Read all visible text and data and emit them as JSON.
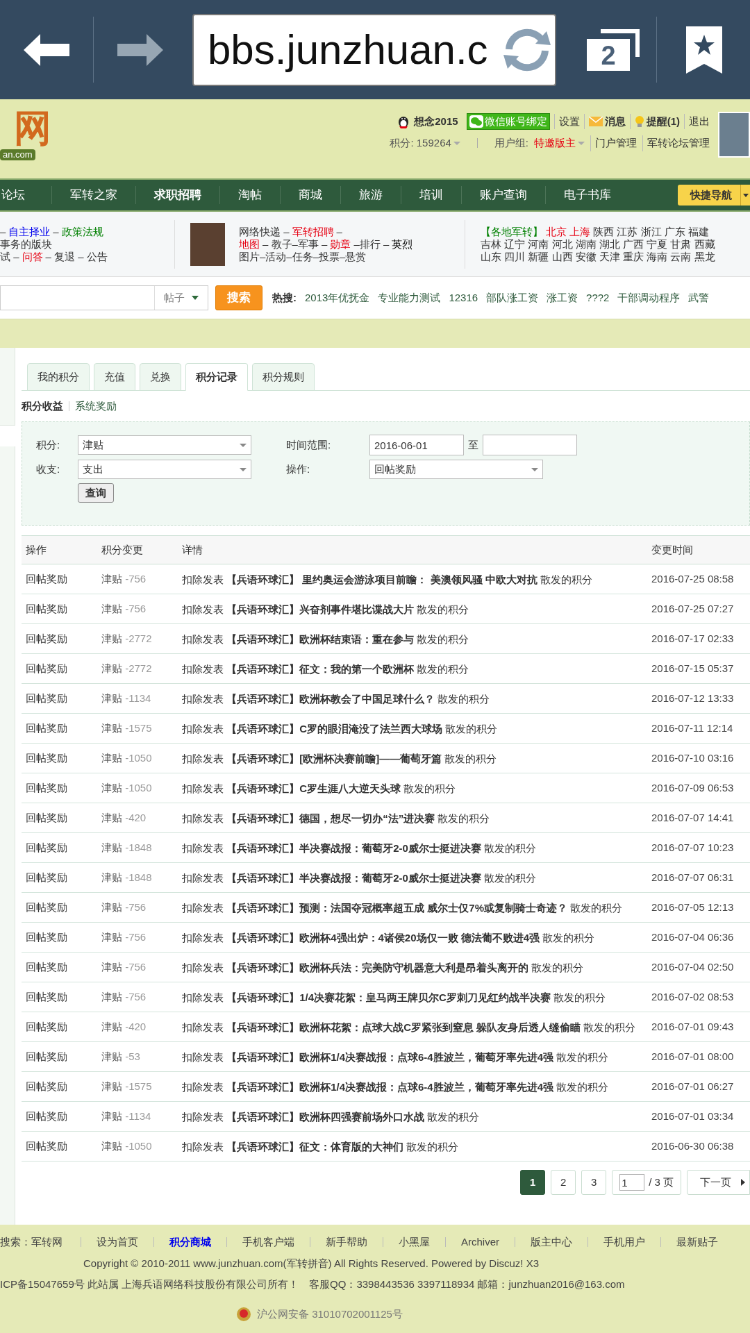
{
  "browser": {
    "url": "bbs.junzhuan.c",
    "tab_count": "2"
  },
  "header": {
    "logo_text": "网",
    "logo_sub": "an.com",
    "user": "想念2015",
    "wechat": "微信账号绑定",
    "settings": "设置",
    "messages": "消息",
    "reminders": "提醒(1)",
    "logout": "退出",
    "points": "积分: 159264",
    "group_label": "用户组:",
    "group": "特邀版主",
    "admin_links": [
      "门户管理",
      "军转论坛管理"
    ]
  },
  "nav": {
    "items": [
      {
        "label": "论坛",
        "bold": false
      },
      {
        "label": "军转之家",
        "bold": false
      },
      {
        "label": "求职招聘",
        "bold": true
      },
      {
        "label": "淘帖",
        "bold": false
      },
      {
        "label": "商城",
        "bold": false
      },
      {
        "label": "旅游",
        "bold": false
      },
      {
        "label": "培训",
        "bold": false
      },
      {
        "label": "账户查询",
        "bold": false
      },
      {
        "label": "电子书库",
        "bold": false
      }
    ],
    "quick_nav": "快捷导航"
  },
  "info": {
    "columns": [
      {
        "lines": [
          [
            {
              "text": "–",
              "color": "#333333"
            },
            {
              "text": "自主择业",
              "color": "#0000ee"
            },
            {
              "text": "–",
              "color": "#333333"
            },
            {
              "text": "政策法规",
              "color": "#008000"
            }
          ],
          [
            {
              "text": "事务的版块",
              "color": "#333333"
            }
          ],
          [
            {
              "text": "试 –",
              "color": "#333333"
            },
            {
              "text": "问答",
              "color": "#e60012"
            },
            {
              "text": "– 复退 – 公告",
              "color": "#333333"
            }
          ]
        ]
      },
      {
        "lines": [
          [
            {
              "text": "网络快递 –",
              "color": "#333333"
            },
            {
              "text": "军转招聘",
              "color": "#e60012"
            },
            {
              "text": "–",
              "color": "#333333"
            }
          ],
          [
            {
              "text": "地图",
              "color": "#e60012"
            },
            {
              "text": "– 教子–军事 –",
              "color": "#333333"
            },
            {
              "text": "勋章",
              "color": "#e60012"
            },
            {
              "text": "–排行 –",
              "color": "#333333"
            },
            {
              "text": "英烈",
              "color": "#000000"
            }
          ],
          [
            {
              "text": "图片–活动–任务–投票–悬赏",
              "color": "#333333"
            }
          ]
        ]
      },
      {
        "lines": [
          [
            {
              "text": "【各地军转】",
              "color": "#008000"
            },
            {
              "text": "北京 上海",
              "color": "#e60012"
            },
            {
              "text": "陕西 江苏 浙江 广东 福建",
              "color": "#333333"
            }
          ],
          [
            {
              "text": "吉林 辽宁 河南 河北 湖南 湖北 广西 宁夏 甘肃 西藏",
              "color": "#333333"
            }
          ],
          [
            {
              "text": "山东 四川 新疆 山西 安徽 天津 重庆 海南 云南 黑龙",
              "color": "#333333"
            }
          ]
        ]
      }
    ]
  },
  "search": {
    "scope": "帖子",
    "button": "搜索",
    "hot_label": "热搜:",
    "hot_terms": [
      "2013年优抚金",
      "专业能力测试",
      "12316",
      "部队涨工资",
      "涨工资",
      "???2",
      "干部调动程序",
      "武警"
    ]
  },
  "tabs": [
    {
      "label": "我的积分",
      "selected": false
    },
    {
      "label": "充值",
      "selected": false
    },
    {
      "label": "兑换",
      "selected": false
    },
    {
      "label": "积分记录",
      "selected": true
    },
    {
      "label": "积分规则",
      "selected": false
    }
  ],
  "subtabs": [
    {
      "label": "积分收益",
      "selected": true
    },
    {
      "label": "系统奖励",
      "selected": false
    }
  ],
  "filter": {
    "points_label": "积分:",
    "points_value": "津贴",
    "flow_label": "收支:",
    "flow_value": "支出",
    "range_label": "时间范围:",
    "range_from": "2016-06-01",
    "range_to_label": "至",
    "action_label": "操作:",
    "action_value": "回帖奖励",
    "query_button": "查询"
  },
  "table": {
    "columns": [
      "操作",
      "积分变更",
      "详情",
      "变更时间"
    ],
    "rows": [
      {
        "action": "回帖奖励",
        "type": "津贴",
        "amount": "-756",
        "prefix": "扣除发表",
        "title": "【兵语环球汇】 里约奥运会游泳项目前瞻： 美澳领风骚 中欧大对抗",
        "suffix": "散发的积分",
        "time": "2016-07-25 08:58"
      },
      {
        "action": "回帖奖励",
        "type": "津贴",
        "amount": "-756",
        "prefix": "扣除发表",
        "title": "【兵语环球汇】兴奋剂事件堪比谍战大片",
        "suffix": "散发的积分",
        "time": "2016-07-25 07:27"
      },
      {
        "action": "回帖奖励",
        "type": "津贴",
        "amount": "-2772",
        "prefix": "扣除发表",
        "title": "【兵语环球汇】欧洲杯结束语：重在参与",
        "suffix": "散发的积分",
        "time": "2016-07-17 02:33"
      },
      {
        "action": "回帖奖励",
        "type": "津贴",
        "amount": "-2772",
        "prefix": "扣除发表",
        "title": "【兵语环球汇】征文：我的第一个欧洲杯",
        "suffix": "散发的积分",
        "time": "2016-07-15 05:37"
      },
      {
        "action": "回帖奖励",
        "type": "津贴",
        "amount": "-1134",
        "prefix": "扣除发表",
        "title": "【兵语环球汇】欧洲杯教会了中国足球什么？",
        "suffix": "散发的积分",
        "time": "2016-07-12 13:33"
      },
      {
        "action": "回帖奖励",
        "type": "津贴",
        "amount": "-1575",
        "prefix": "扣除发表",
        "title": "【兵语环球汇】C罗的眼泪淹没了法兰西大球场",
        "suffix": "散发的积分",
        "time": "2016-07-11 12:14"
      },
      {
        "action": "回帖奖励",
        "type": "津贴",
        "amount": "-1050",
        "prefix": "扣除发表",
        "title": "【兵语环球汇】[欧洲杯决赛前瞻]——葡萄牙篇",
        "suffix": "散发的积分",
        "time": "2016-07-10 03:16"
      },
      {
        "action": "回帖奖励",
        "type": "津贴",
        "amount": "-1050",
        "prefix": "扣除发表",
        "title": "【兵语环球汇】C罗生涯八大逆天头球",
        "suffix": "散发的积分",
        "time": "2016-07-09 06:53"
      },
      {
        "action": "回帖奖励",
        "type": "津贴",
        "amount": "-420",
        "prefix": "扣除发表",
        "title": "【兵语环球汇】德国，想尽一切办“法”进决赛",
        "suffix": "散发的积分",
        "time": "2016-07-07 14:41"
      },
      {
        "action": "回帖奖励",
        "type": "津贴",
        "amount": "-1848",
        "prefix": "扣除发表",
        "title": "【兵语环球汇】半决赛战报：葡萄牙2-0威尔士挺进决赛",
        "suffix": "散发的积分",
        "time": "2016-07-07 10:23"
      },
      {
        "action": "回帖奖励",
        "type": "津贴",
        "amount": "-1848",
        "prefix": "扣除发表",
        "title": "【兵语环球汇】半决赛战报：葡萄牙2-0威尔士挺进决赛",
        "suffix": "散发的积分",
        "time": "2016-07-07 06:31"
      },
      {
        "action": "回帖奖励",
        "type": "津贴",
        "amount": "-756",
        "prefix": "扣除发表",
        "title": "【兵语环球汇】预测：法国夺冠概率超五成 威尔士仅7%或复制骑士奇迹？",
        "suffix": "散发的积分",
        "time": "2016-07-05 12:13"
      },
      {
        "action": "回帖奖励",
        "type": "津贴",
        "amount": "-756",
        "prefix": "扣除发表",
        "title": "【兵语环球汇】欧洲杯4强出炉：4诸侯20场仅一败 德法葡不败进4强",
        "suffix": "散发的积分",
        "time": "2016-07-04 06:36"
      },
      {
        "action": "回帖奖励",
        "type": "津贴",
        "amount": "-756",
        "prefix": "扣除发表",
        "title": "【兵语环球汇】欧洲杯兵法：完美防守机器意大利是昂着头离开的",
        "suffix": "散发的积分",
        "time": "2016-07-04 02:50"
      },
      {
        "action": "回帖奖励",
        "type": "津贴",
        "amount": "-756",
        "prefix": "扣除发表",
        "title": "【兵语环球汇】1/4决赛花絮：皇马两王牌贝尔C罗刺刀见红约战半决赛",
        "suffix": "散发的积分",
        "time": "2016-07-02 08:53"
      },
      {
        "action": "回帖奖励",
        "type": "津贴",
        "amount": "-420",
        "prefix": "扣除发表",
        "title": "【兵语环球汇】欧洲杯花絮：点球大战C罗紧张到窒息 躲队友身后透人缝偷瞄",
        "suffix": "散发的积分",
        "time": "2016-07-01 09:43"
      },
      {
        "action": "回帖奖励",
        "type": "津贴",
        "amount": "-53",
        "prefix": "扣除发表",
        "title": "【兵语环球汇】欧洲杯1/4决赛战报：点球6-4胜波兰，葡萄牙率先进4强",
        "suffix": "散发的积分",
        "time": "2016-07-01 08:00"
      },
      {
        "action": "回帖奖励",
        "type": "津贴",
        "amount": "-1575",
        "prefix": "扣除发表",
        "title": "【兵语环球汇】欧洲杯1/4决赛战报：点球6-4胜波兰，葡萄牙率先进4强",
        "suffix": "散发的积分",
        "time": "2016-07-01 06:27"
      },
      {
        "action": "回帖奖励",
        "type": "津贴",
        "amount": "-1134",
        "prefix": "扣除发表",
        "title": "【兵语环球汇】欧洲杯四强赛前场外口水战",
        "suffix": "散发的积分",
        "time": "2016-07-01 03:34"
      },
      {
        "action": "回帖奖励",
        "type": "津贴",
        "amount": "-1050",
        "prefix": "扣除发表",
        "title": "【兵语环球汇】征文：体育版的大神们",
        "suffix": "散发的积分",
        "time": "2016-06-30 06:38"
      }
    ]
  },
  "pagination": {
    "pages": [
      {
        "label": "1",
        "selected": true
      },
      {
        "label": "2",
        "selected": false
      },
      {
        "label": "3",
        "selected": false
      }
    ],
    "page_input": "1",
    "total": "/ 3 页",
    "next": "下一页"
  },
  "footer": {
    "links": [
      {
        "label": "搜索：军转网",
        "bold": false
      },
      {
        "label": "设为首页",
        "bold": false
      },
      {
        "label": "积分商城",
        "bold": true
      },
      {
        "label": "手机客户端",
        "bold": false
      },
      {
        "label": "新手帮助",
        "bold": false
      },
      {
        "label": "小黑屋",
        "bold": false
      },
      {
        "label": "Archiver",
        "bold": false
      },
      {
        "label": "版主中心",
        "bold": false
      },
      {
        "label": "手机用户",
        "bold": false
      },
      {
        "label": "最新贴子",
        "bold": false
      }
    ],
    "copyright": "Copyright © 2010-2011 www.junzhuan.com(军转拼音) All Rights Reserved. Powered by Discuz! X3",
    "icp": "ICP备15047659号 此站属 上海兵语网络科技股份有限公司所有！　客服QQ：3398443536 3397118934 邮箱：junzhuan2016@163.com",
    "police": "沪公网安备 31010702001125号"
  }
}
